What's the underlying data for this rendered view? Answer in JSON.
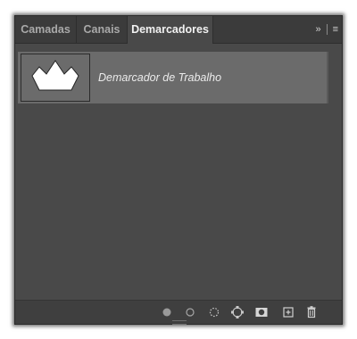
{
  "tabs": [
    {
      "label": "Camadas",
      "active": false
    },
    {
      "label": "Canais",
      "active": false
    },
    {
      "label": "Demarcadores",
      "active": true
    }
  ],
  "header_controls": {
    "collapse_glyph": "»",
    "menu_glyph": "≡"
  },
  "paths": [
    {
      "name": "Demarcador de Trabalho",
      "selected": true
    }
  ],
  "footer_buttons": [
    {
      "name": "fill-path-icon"
    },
    {
      "name": "stroke-path-icon"
    },
    {
      "name": "load-path-as-selection-icon"
    },
    {
      "name": "make-work-path-from-selection-icon"
    },
    {
      "name": "add-mask-icon"
    },
    {
      "name": "create-new-path-icon"
    },
    {
      "name": "delete-path-icon"
    }
  ],
  "colors": {
    "panel": "#494949",
    "tabbar": "#3b3b3b",
    "selected_row": "#6b6b6b",
    "text": "#ebebeb"
  }
}
